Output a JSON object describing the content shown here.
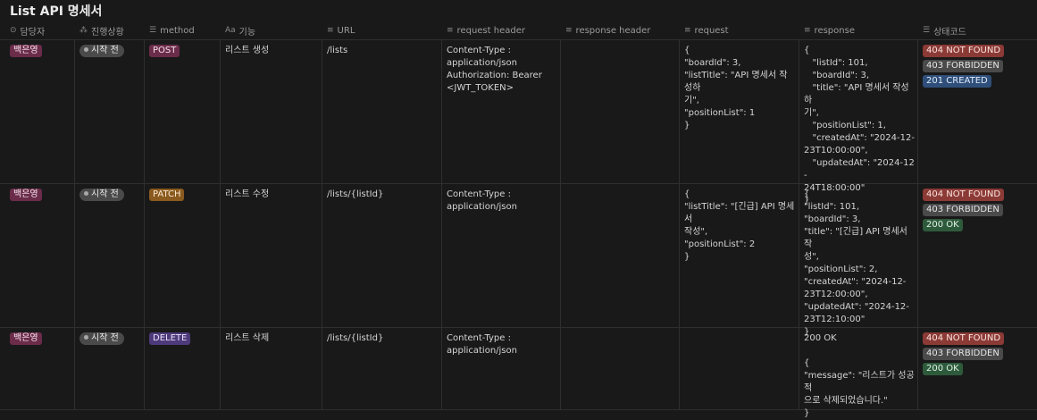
{
  "page": {
    "title": "List API 명세서"
  },
  "columns": [
    {
      "icon": "person-circle-icon",
      "glyph": "⊙",
      "label": "담당자"
    },
    {
      "icon": "status-spinner-icon",
      "glyph": "⁂",
      "label": "진행상황"
    },
    {
      "icon": "list-icon",
      "glyph": "☰",
      "label": "method"
    },
    {
      "icon": "text-icon",
      "glyph": "Aa",
      "label": "기능"
    },
    {
      "icon": "text-lines-icon",
      "glyph": "≡",
      "label": "URL"
    },
    {
      "icon": "text-lines-icon",
      "glyph": "≡",
      "label": "request header"
    },
    {
      "icon": "text-lines-icon",
      "glyph": "≡",
      "label": "response header"
    },
    {
      "icon": "text-lines-icon",
      "glyph": "≡",
      "label": "request"
    },
    {
      "icon": "text-lines-icon",
      "glyph": "≡",
      "label": "response"
    },
    {
      "icon": "list-icon",
      "glyph": "☰",
      "label": "상태코드"
    }
  ],
  "rows": [
    {
      "owner": "백은영",
      "status": "시작 전",
      "method": "POST",
      "feature": "리스트 생성",
      "url": "/lists",
      "request_header": "Content-Type :\napplication/json\nAuthorization: Bearer\n<JWT_TOKEN>",
      "response_header": "",
      "request": "{\n\"boardId\": 3,\n\"listTitle\": \"API 명세서 작성하\n기\",\n\"positionList\": 1\n}",
      "response": "{\n   \"listId\": 101,\n   \"boardId\": 3,\n   \"title\": \"API 명세서 작성하\n기\",\n   \"positionList\": 1,\n   \"createdAt\": \"2024-12-\n23T10:00:00\",\n   \"updatedAt\": \"2024-12-\n24T18:00:00\"\n}",
      "codes": [
        "404 NOT FOUND",
        "403 FORBIDDEN",
        "201 CREATED"
      ]
    },
    {
      "owner": "백은영",
      "status": "시작 전",
      "method": "PATCH",
      "feature": "리스트 수정",
      "url": "/lists/{listId}",
      "request_header": "Content-Type :\napplication/json",
      "response_header": "",
      "request": "{\n\"listTitle\": \"[긴급] API 명세서\n작성\",\n\"positionList\": 2\n}",
      "response": "{\n\"listId\": 101,\n\"boardId\": 3,\n\"title\": \"[긴급] API 명세서 작\n성\",\n\"positionList\": 2,\n\"createdAt\": \"2024-12-\n23T12:00:00\",\n\"updatedAt\": \"2024-12-\n23T12:10:00\"\n}",
      "codes": [
        "404 NOT FOUND",
        "403 FORBIDDEN",
        "200 OK"
      ]
    },
    {
      "owner": "백은영",
      "status": "시작 전",
      "method": "DELETE",
      "feature": "리스트 삭제",
      "url": "/lists/{listId}",
      "request_header": "Content-Type :\napplication/json",
      "response_header": "",
      "request": "",
      "response": "200 OK\n\n{\n\"message\": \"리스트가 성공적\n으로 삭제되었습니다.\"\n}",
      "codes": [
        "404 NOT FOUND",
        "403 FORBIDDEN",
        "200 OK"
      ]
    }
  ]
}
